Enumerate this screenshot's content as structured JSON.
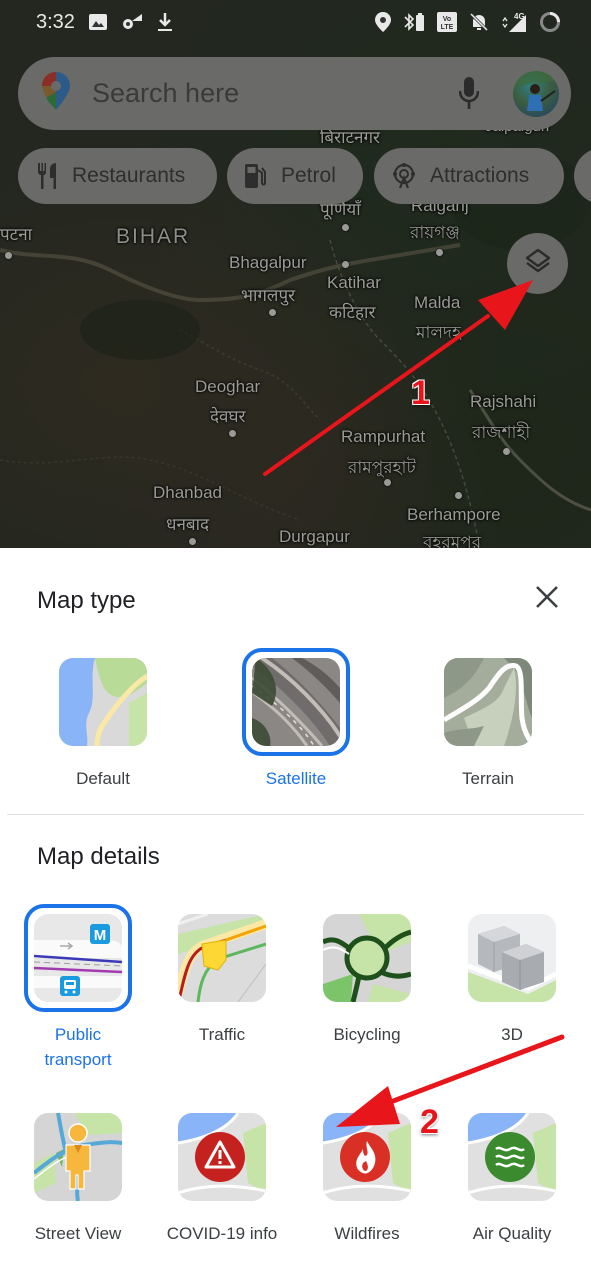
{
  "status_bar": {
    "time": "3:32",
    "left_icons": [
      "gallery-icon",
      "settings-sync-icon",
      "download-icon"
    ],
    "right_icons": [
      "location-icon",
      "bluetooth-battery-icon",
      "volte-icon",
      "bell-off-icon",
      "signal-4g-icon",
      "loading-circle-icon"
    ],
    "network_label": "4G",
    "volte_label": "Vo LTE"
  },
  "search": {
    "placeholder": "Search here",
    "logo_icon": "google-maps-pin-icon",
    "mic_icon": "microphone-icon",
    "avatar": "user-avatar"
  },
  "chips": [
    {
      "label": "Restaurants",
      "icon": "fork-knife-icon"
    },
    {
      "label": "Petrol",
      "icon": "fuel-pump-icon"
    },
    {
      "label": "Attractions",
      "icon": "ferris-wheel-icon"
    }
  ],
  "layers_button": {
    "icon": "layers-icon"
  },
  "map_labels": [
    {
      "text": "BIHAR",
      "kind": "state"
    },
    {
      "text": "Bhagalpur"
    },
    {
      "text": "भागलपुर"
    },
    {
      "text": "Katihar"
    },
    {
      "text": "कटिहार"
    },
    {
      "text": "Malda"
    },
    {
      "text": "মালদহ"
    },
    {
      "text": "Deoghar"
    },
    {
      "text": "देवघर"
    },
    {
      "text": "Rajshahi"
    },
    {
      "text": "রাজশাহী"
    },
    {
      "text": "Rampurhat"
    },
    {
      "text": "রামপুরহাট"
    },
    {
      "text": "Dhanbad"
    },
    {
      "text": "धनबाद"
    },
    {
      "text": "Durgapur"
    },
    {
      "text": "Berhampore"
    },
    {
      "text": "বহরমপুর"
    },
    {
      "text": "बिराटनगर"
    },
    {
      "text": "पूर्णियाँ"
    },
    {
      "text": "Raiganj"
    },
    {
      "text": "রায়গঞ্জ"
    },
    {
      "text": "पटना"
    },
    {
      "text": "Jalpaiguri"
    }
  ],
  "annotations": [
    {
      "number": "1",
      "target": "layers-button"
    },
    {
      "number": "2",
      "target": "wildfires-tile"
    }
  ],
  "sheet": {
    "map_type_title": "Map type",
    "close_icon": "close-icon",
    "map_types": [
      {
        "label": "Default",
        "selected": false
      },
      {
        "label": "Satellite",
        "selected": true
      },
      {
        "label": "Terrain",
        "selected": false
      }
    ],
    "map_details_title": "Map details",
    "map_details": [
      {
        "label": "Public transport",
        "line1": "Public",
        "line2": "transport",
        "selected": true
      },
      {
        "label": "Traffic",
        "selected": false
      },
      {
        "label": "Bicycling",
        "selected": false
      },
      {
        "label": "3D",
        "selected": false
      },
      {
        "label": "Street View",
        "selected": false
      },
      {
        "label": "COVID-19 info",
        "selected": false
      },
      {
        "label": "Wildfires",
        "selected": false
      },
      {
        "label": "Air Quality",
        "selected": false
      }
    ]
  },
  "colors": {
    "accent_blue": "#1a73e8",
    "annotation_red": "#e8151b",
    "chip_overlay": "#6a6a68"
  }
}
